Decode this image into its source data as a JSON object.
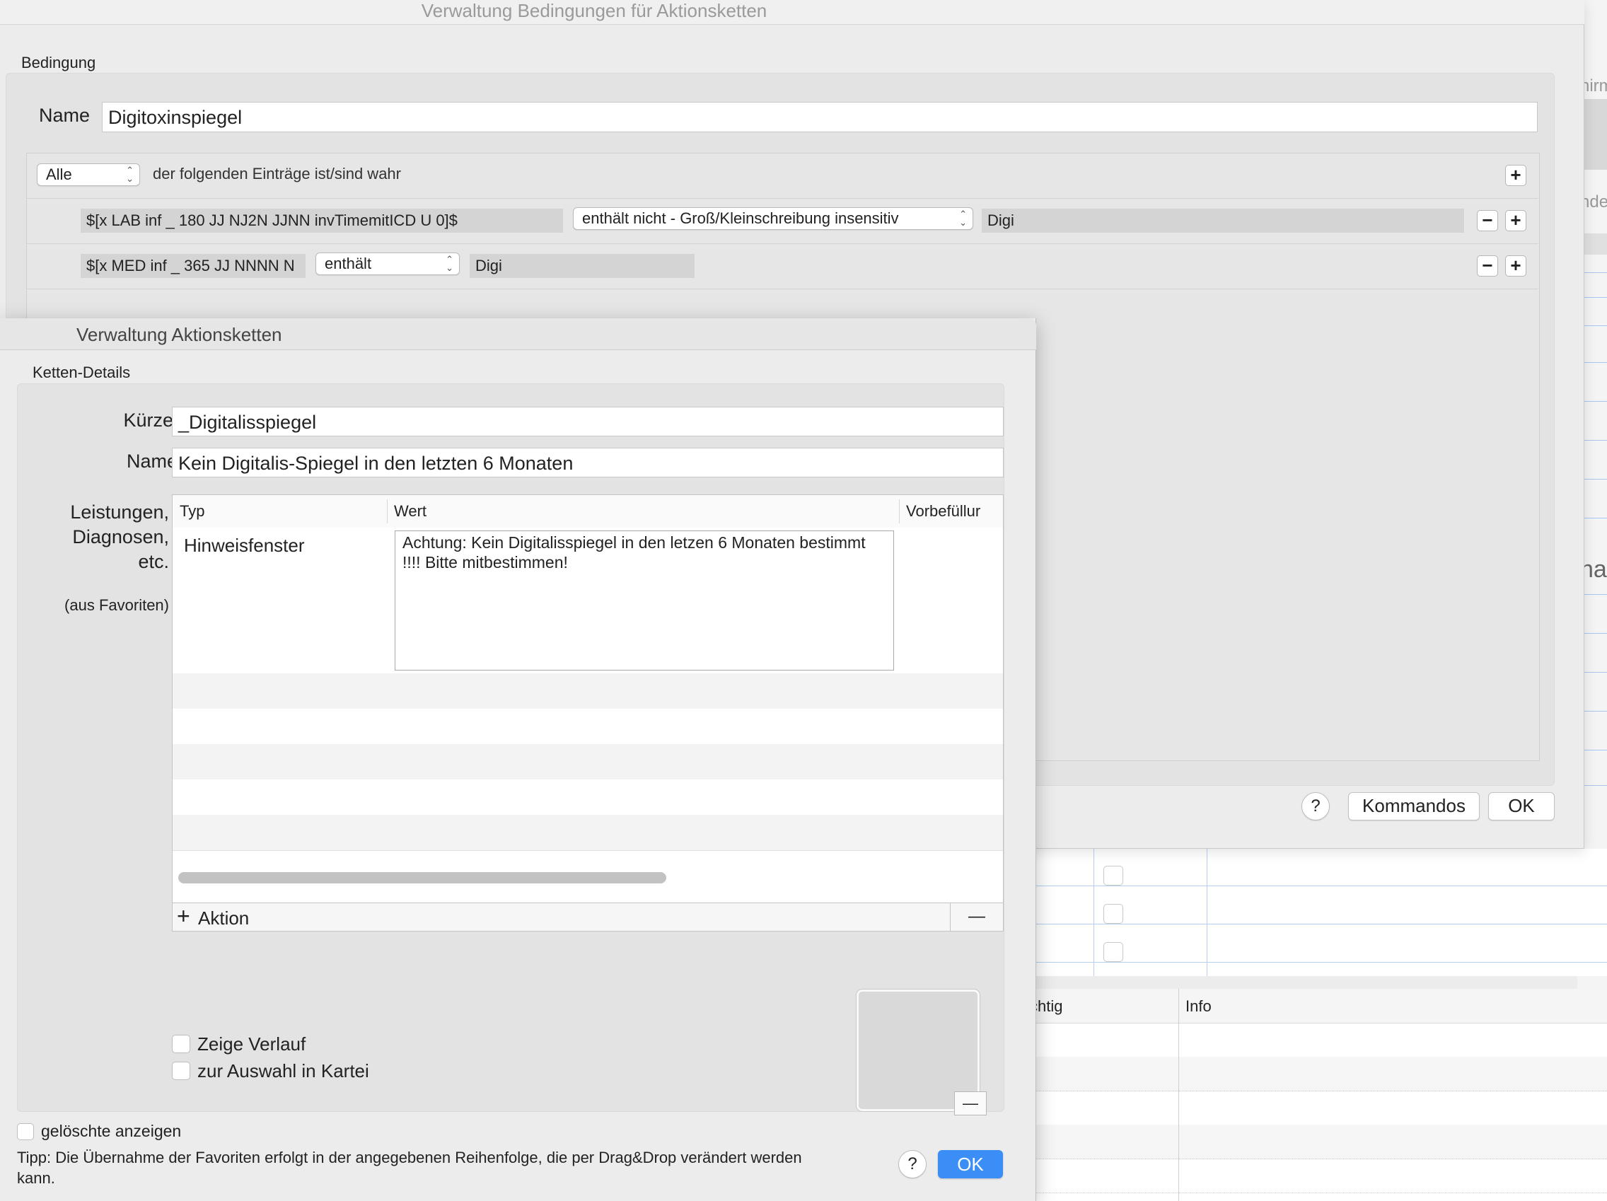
{
  "background_app": {
    "fragments": [
      "hirm",
      "nde",
      "ha"
    ],
    "table_header": {
      "col1": "chtig",
      "col2": "Info"
    }
  },
  "conditions_window": {
    "title": "Verwaltung Bedingungen für Aktionsketten",
    "section_label": "Bedingung",
    "name_label": "Name",
    "name_value": "Digitoxinspiegel",
    "match_mode": "Alle",
    "match_text": "der folgenden Einträge ist/sind wahr",
    "rules": [
      {
        "field": "$[x LAB inf _ 180 JJ NJ2N JJNN invTimemitICD U 0]$",
        "operator": "enthält nicht - Groß/Kleinschreibung insensitiv",
        "value": "Digi"
      },
      {
        "field": "$[x MED inf _ 365 JJ NNNN N",
        "operator": "enthält",
        "value": "Digi"
      }
    ],
    "add_symbol": "+",
    "remove_symbol": "−",
    "help_label": "?",
    "commands_label": "Kommandos",
    "ok_label": "OK"
  },
  "chains_window": {
    "title": "Verwaltung Aktionsketten",
    "section_label": "Ketten-Details",
    "short_label": "Kürzel",
    "short_value": "_Digitalisspiegel",
    "name_label": "Name",
    "name_value": "Kein Digitalis-Spiegel in den letzten 6 Monaten",
    "services_label_1": "Leistungen,",
    "services_label_2": "Diagnosen,",
    "services_label_3": "etc.",
    "favorites_label": "(aus Favoriten)",
    "table": {
      "columns": [
        "Typ",
        "Wert",
        "Vorbefüllur"
      ],
      "rows": [
        {
          "type": "Hinweisfenster",
          "value": "Achtung: Kein Digitalisspiegel in den letzen 6 Monaten bestimmt !!!! Bitte mitbestimmen!"
        }
      ]
    },
    "add_action_label": "Aktion",
    "add_action_symbol": "+",
    "remove_action_symbol": "—",
    "checkbox_history": "Zeige Verlauf",
    "checkbox_selection": "zur Auswahl in Kartei",
    "image_remove_symbol": "—",
    "checkbox_deleted": "gelöschte anzeigen",
    "tip": "Tipp: Die Übernahme der Favoriten erfolgt in der angegebenen Reihenfolge, die per Drag&Drop verändert werden kann.",
    "help_label": "?",
    "ok_label": "OK",
    "colors": {
      "accent": "#3b8ef5"
    }
  }
}
